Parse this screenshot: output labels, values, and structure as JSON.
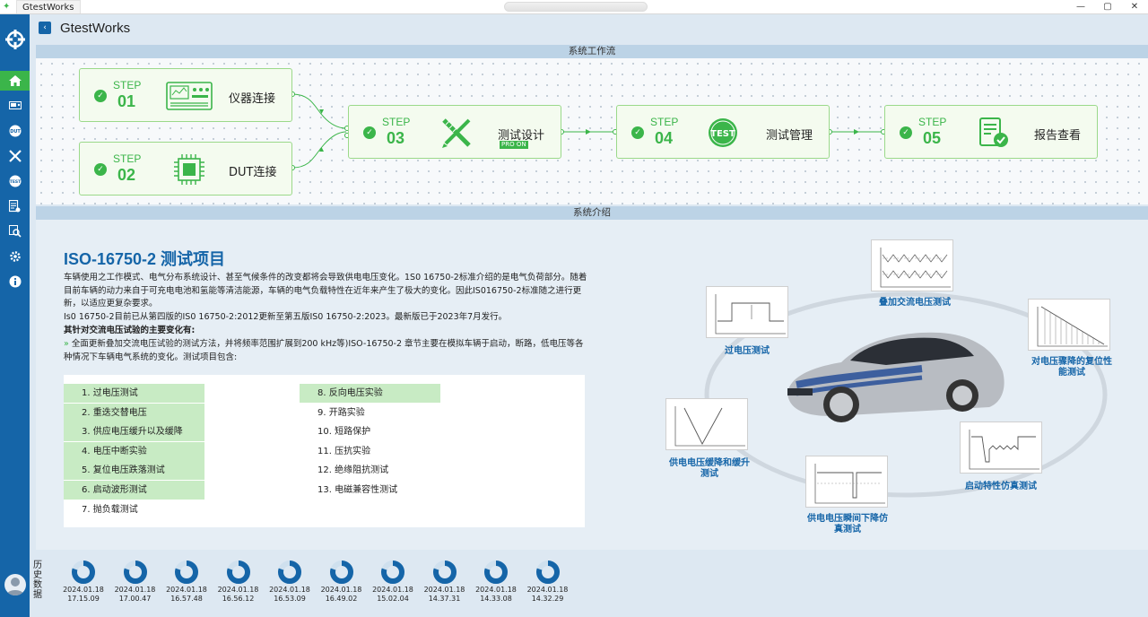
{
  "window": {
    "tab_title": "GtestWorks",
    "controls": [
      "—",
      "▢",
      "✕"
    ]
  },
  "header": {
    "title": "GtestWorks"
  },
  "sidebar": {
    "items": [
      {
        "icon": "home-icon",
        "active": true
      },
      {
        "icon": "instrument-icon",
        "active": false
      },
      {
        "icon": "dut-icon",
        "active": false
      },
      {
        "icon": "tools-icon",
        "active": false
      },
      {
        "icon": "test-icon",
        "active": false
      },
      {
        "icon": "report-icon",
        "active": false
      },
      {
        "icon": "search-icon",
        "active": false
      },
      {
        "icon": "settings-icon",
        "active": false
      },
      {
        "icon": "info-icon",
        "active": false
      }
    ]
  },
  "workflow": {
    "section_title": "系统工作流",
    "steps": [
      {
        "word": "STEP",
        "num": "01",
        "label": "仪器连接",
        "icon": "instrument-panel-icon"
      },
      {
        "word": "STEP",
        "num": "02",
        "label": "DUT连接",
        "icon": "chip-icon"
      },
      {
        "word": "STEP",
        "num": "03",
        "label": "测试设计",
        "icon": "design-tools-icon",
        "badge": "PRO ON"
      },
      {
        "word": "STEP",
        "num": "04",
        "label": "测试管理",
        "icon": "test-badge-icon",
        "icon_text": "TEST"
      },
      {
        "word": "STEP",
        "num": "05",
        "label": "报告查看",
        "icon": "report-check-icon"
      }
    ]
  },
  "intro": {
    "section_title": "系统介绍",
    "heading": "ISO-16750-2 测试项目",
    "p1": "车辆使用之工作模式、电气分布系统设计、甚至气候条件的改变都将会导致供电电压变化。1S0 16750-2标准介绍的是电气负荷部分。随着目前车辆的动力来自于可充电电池和氢能等清洁能源，车辆的电气负载特性在近年来产生了极大的变化。因此IS016750-2标准随之进行更新，以适应更复杂要求。",
    "p2": "Is0 16750-2目前已从第四版的IS0 16750-2:2012更新至第五版IS0 16750-2:2023。最新版已于2023年7月发行。",
    "p3": "其针对交流电压试验的主要变化有:",
    "p4_arrow": "»",
    "p4": " 全面更新叠加交流电压试验的测试方法，并将频率范围扩展到200 kHz等)ISO-16750-2 章节主要在模拟车辆于启动，断路，低电压等各种情况下车辆电气系统的变化。测试项目包含:",
    "items_left": [
      {
        "text": "1. 过电压测试",
        "highlight": true
      },
      {
        "text": "2. 重迭交替电压",
        "highlight": true
      },
      {
        "text": "3. 供应电压缓升以及缓降",
        "highlight": true
      },
      {
        "text": "4. 电压中断实验",
        "highlight": true
      },
      {
        "text": "5. 复位电压跌落测试",
        "highlight": true
      },
      {
        "text": "6. 启动波形测试",
        "highlight": true
      },
      {
        "text": "7. 抛负载测试",
        "highlight": false
      }
    ],
    "items_right": [
      {
        "text": "8. 反向电压实验",
        "highlight": true
      },
      {
        "text": "9. 开路实验",
        "highlight": false
      },
      {
        "text": "10. 短路保护",
        "highlight": false
      },
      {
        "text": "11. 压抗实验",
        "highlight": false
      },
      {
        "text": "12. 绝缘阻抗测试",
        "highlight": false
      },
      {
        "text": "13. 电磁兼容性测试",
        "highlight": false
      }
    ],
    "diagram_labels": {
      "overlay_ac": "叠加交流电压测试",
      "overvoltage": "过电压测试",
      "sudden_drop": "对电压骤降的复位性能测试",
      "ramp": "供电电压缓降和缓升测试",
      "start": "启动特性仿真测试",
      "transient": "供电电压瞬间下降仿真测试"
    }
  },
  "history": {
    "label": "历史数据",
    "items": [
      {
        "date": "2024.01.18",
        "time": "17.15.09",
        "fraction": 0.8
      },
      {
        "date": "2024.01.18",
        "time": "17.00.47",
        "fraction": 0.8
      },
      {
        "date": "2024.01.18",
        "time": "16.57.48",
        "fraction": 0.8
      },
      {
        "date": "2024.01.18",
        "time": "16.56.12",
        "fraction": 0.8
      },
      {
        "date": "2024.01.18",
        "time": "16.53.09",
        "fraction": 0.8
      },
      {
        "date": "2024.01.18",
        "time": "16.49.02",
        "fraction": 0.8
      },
      {
        "date": "2024.01.18",
        "time": "15.02.04",
        "fraction": 0.8
      },
      {
        "date": "2024.01.18",
        "time": "14.37.31",
        "fraction": 0.8
      },
      {
        "date": "2024.01.18",
        "time": "14.33.08",
        "fraction": 0.8
      },
      {
        "date": "2024.01.18",
        "time": "14.32.29",
        "fraction": 0.8
      }
    ]
  },
  "colors": {
    "brand_blue": "#1565a8",
    "accent_green": "#3bb54a",
    "highlight_green": "#c8ebc4"
  }
}
